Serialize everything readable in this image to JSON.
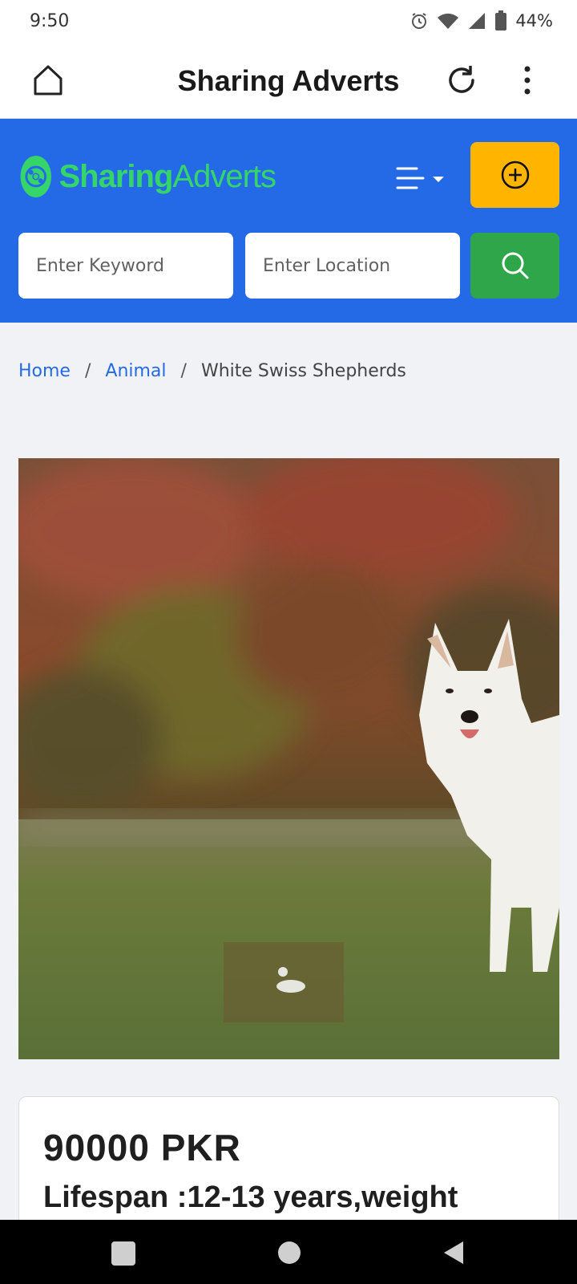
{
  "status_bar": {
    "time": "9:50",
    "battery": "44%",
    "icons": [
      "alarm-icon",
      "wifi-icon",
      "signal-icon",
      "battery-icon"
    ]
  },
  "app_bar": {
    "title": "Sharing Adverts",
    "icons": [
      "home-icon",
      "reload-icon",
      "more-vertical-icon"
    ]
  },
  "header": {
    "logo_part1": "Sharing",
    "logo_part2": "Adverts",
    "keyword_placeholder": "Enter Keyword",
    "location_placeholder": "Enter Location",
    "colors": {
      "header_bg": "#246ae6",
      "logo": "#36d56a",
      "post_button": "#ffb400",
      "search_button": "#2fa64a"
    }
  },
  "breadcrumb": {
    "items": [
      "Home",
      "Animal",
      "White Swiss Shepherds"
    ],
    "separator": "/"
  },
  "listing": {
    "image_alt": "White Swiss Shepherd dog standing on grass",
    "price": "90000 PKR",
    "title": "Lifespan :12-13 years,weight"
  },
  "nav_bar": {
    "icons": [
      "recents-icon",
      "home-circle-icon",
      "back-icon"
    ]
  }
}
